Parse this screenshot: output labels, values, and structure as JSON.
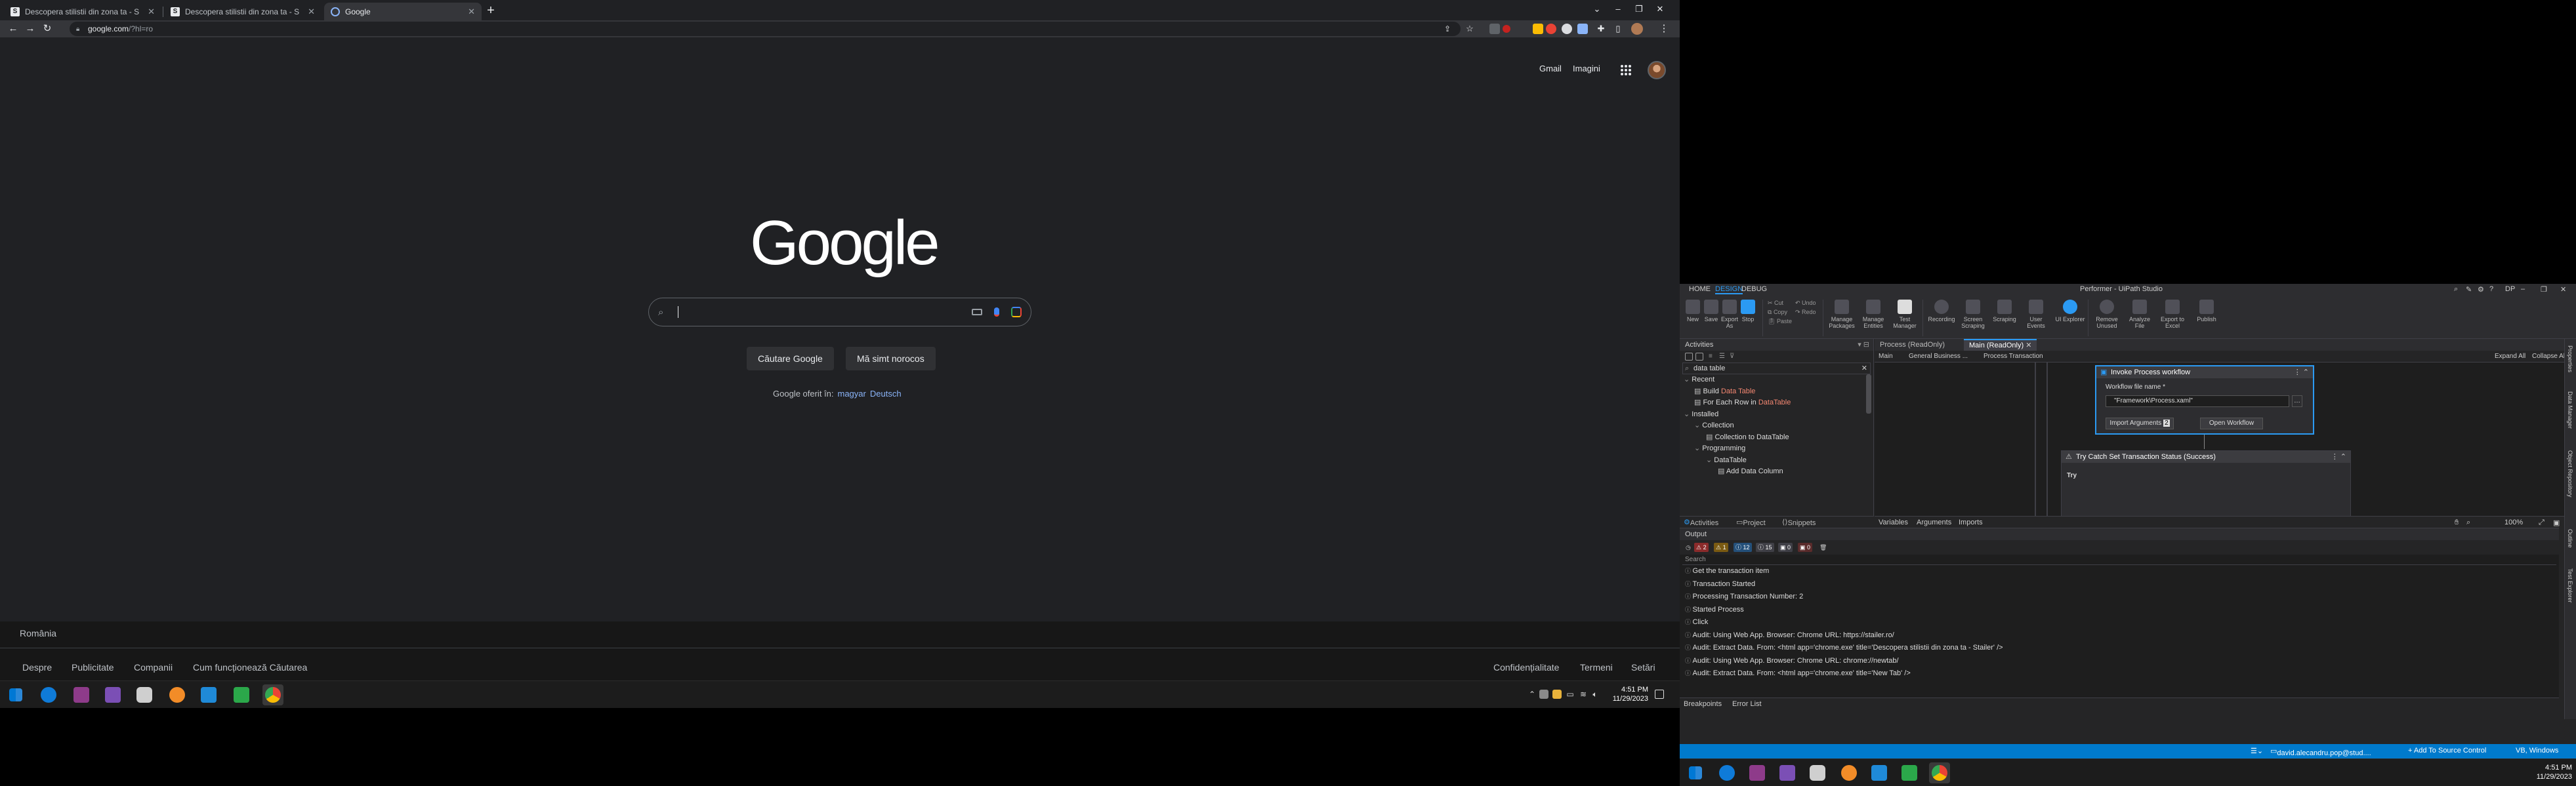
{
  "chrome": {
    "tabs": [
      {
        "title": "Descopera stilistii din zona ta - S",
        "active": false
      },
      {
        "title": "Descopera stilistii din zona ta - S",
        "active": false
      },
      {
        "title": "Google",
        "active": true
      }
    ],
    "url_host": "google.com",
    "url_rest": "/?hl=ro",
    "top_links": [
      "Gmail",
      "Imagini"
    ],
    "logo": "Google",
    "search_placeholder": "",
    "search_button": "Căutare Google",
    "lucky_button": "Mă simt norocos",
    "offered_in": "Google oferit în:",
    "languages": [
      "magyar",
      "Deutsch"
    ],
    "country": "România",
    "footer_left": [
      "Despre",
      "Publicitate",
      "Companii",
      "Cum funcționează Căutarea"
    ],
    "footer_right": [
      "Confidențialitate",
      "Termeni",
      "Setări"
    ]
  },
  "taskbar_left": {
    "time": "4:51 PM",
    "date": "11/29/2023"
  },
  "studio": {
    "window_title": "Performer - UiPath Studio",
    "menu": [
      "HOME",
      "DESIGN",
      "DEBUG"
    ],
    "user_initials": "DP",
    "ribbon": {
      "new": "New",
      "save": "Save",
      "export": "Export As",
      "stop": "Stop",
      "cut": "Cut",
      "copy": "Copy",
      "paste": "Paste",
      "undo": "Undo",
      "redo": "Redo",
      "manage_packages": "Manage Packages",
      "manage_entities": "Manage Entities",
      "test_manager": "Test Manager",
      "recording": "Recording",
      "screen_scraping": "Screen Scraping",
      "data_scraping": "Scraping",
      "user_events": "User Events",
      "ui_explorer": "UI Explorer",
      "remove_unused": "Remove Unused",
      "analyze_file": "Analyze File",
      "export_excel": "Export to Excel",
      "publish": "Publish"
    },
    "activities": {
      "header": "Activities",
      "search": "data table",
      "tree": [
        {
          "label": "Recent",
          "indent": 0,
          "arrow": "v"
        },
        {
          "label_pre": "Build ",
          "label_hl": "Data Table",
          "indent": 1
        },
        {
          "label_pre": "For Each Row in ",
          "label_hl": "DataTable",
          "indent": 1
        },
        {
          "label": "Installed",
          "indent": 0,
          "arrow": "v"
        },
        {
          "label": "Collection",
          "indent": 1,
          "arrow": "v"
        },
        {
          "label": "Collection to DataTable",
          "indent": 2
        },
        {
          "label": "Programming",
          "indent": 1,
          "arrow": "v"
        },
        {
          "label": "DataTable",
          "indent": 2,
          "arrow": "v"
        },
        {
          "label": "Add Data Column",
          "indent": 3
        }
      ],
      "tabs": [
        "Activities",
        "Project",
        "Snippets"
      ]
    },
    "designer": {
      "tabs": [
        "Process (ReadOnly)",
        "Main (ReadOnly)"
      ],
      "breadcrumb": [
        "Main",
        "General Business ...",
        "Process Transaction"
      ],
      "expand_all": "Expand All",
      "collapse_all": "Collapse All",
      "invoke_title": "Invoke Process workflow",
      "file_label": "Workflow file name *",
      "file_value": "\"Framework\\Process.xaml\"",
      "import_args": "Import Arguments",
      "import_count": "2",
      "open_workflow": "Open Workflow",
      "try_catch_title": "Try Catch Set Transaction Status (Success)",
      "try_label": "Try",
      "footer_tabs": [
        "Variables",
        "Arguments",
        "Imports"
      ],
      "zoom": "100%"
    },
    "output": {
      "header": "Output",
      "filter_counts": [
        "2",
        "1",
        "12",
        "15",
        "0",
        "0"
      ],
      "search": "Search",
      "lines": [
        "Get the transaction item",
        "Transaction Started",
        "Processing Transaction Number: 2",
        "Started Process",
        "Click",
        "Audit: Using Web App. Browser: Chrome URL: https://stailer.ro/",
        "Audit: Extract Data. From: <html app='chrome.exe' title='Descopera stilistii din zona ta - Stailer' />",
        "Audit: Using Web App. Browser: Chrome URL: chrome://newtab/",
        "Audit: Extract Data. From: <html app='chrome.exe' title='New Tab' />"
      ],
      "tabs": [
        "Breakpoints",
        "Error List"
      ]
    },
    "right_rail": [
      "Properties",
      "Data Manager",
      "Object Repository",
      "Outline",
      "Test Explorer"
    ],
    "status": {
      "user": "david.alecandru.pop@stud....",
      "source_control": "+ Add To Source Control",
      "platform": "VB, Windows"
    }
  },
  "taskbar_right": {
    "time": "4:51 PM",
    "date": "11/29/2023"
  },
  "colors": {
    "accent": "#2b9af3",
    "status": "#007acc",
    "highlight": "#f48771",
    "link": "#8ab4f8"
  }
}
